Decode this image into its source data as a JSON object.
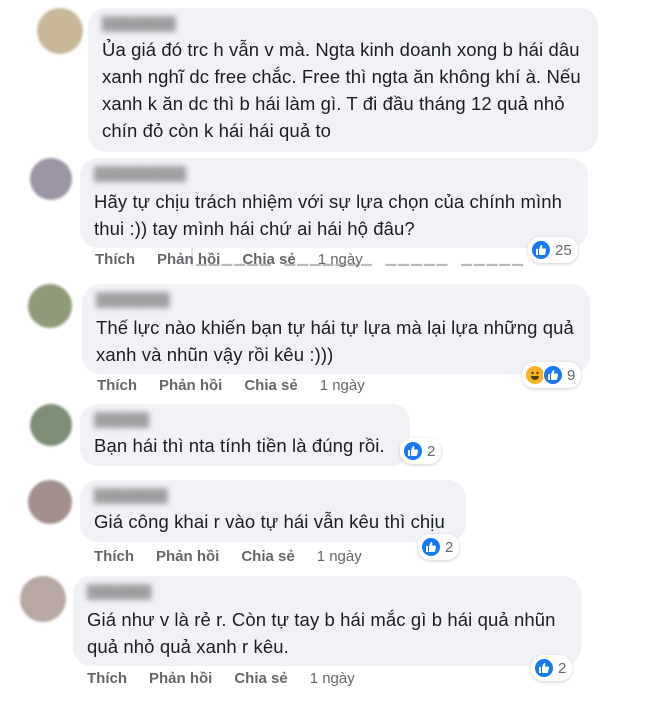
{
  "colors": {
    "bubble_bg": "#f0f2f5",
    "like_blue": "#1877f2",
    "haha_yellow": "#f7b125",
    "meta_gray": "#65676b"
  },
  "icons": {
    "like": "like-thumb-icon",
    "haha": "haha-face-icon"
  },
  "comments": [
    {
      "text": "Ủa giá đó trc h vẫn v mà. Ngta kinh doanh xong b hái dâu xanh nghĩ dc free chắc. Free thì ngta ăn không khí à. Nếu xanh k ăn dc thì b hái làm gì. T đi đầu tháng 12 quả nhỏ chín đỏ còn k hái hái quả to"
    },
    {
      "text": "Hãy tự chịu trách nhiệm với sự lựa chọn của chính mình thui :)) tay mình hái chứ ai hái hộ đâu?",
      "reactions": "25",
      "actions": {
        "like": "Thích",
        "reply": "Phản hồi",
        "share": "Chia sẻ",
        "time": "1 ngày"
      }
    },
    {
      "text": "Thế lực nào khiến bạn tự hái tự lựa mà lại lựa những quả xanh và nhũn vậy rồi kêu :)))",
      "reactions": "9",
      "actions": {
        "like": "Thích",
        "reply": "Phản hồi",
        "share": "Chia sẻ",
        "time": "1 ngày"
      }
    },
    {
      "text": "Bạn hái thì nta tính tiền là đúng rồi.",
      "reactions": "2"
    },
    {
      "text": "Giá công khai r vào tự hái vẫn kêu thì chịu",
      "reactions": "2",
      "actions": {
        "like": "Thích",
        "reply": "Phản hồi",
        "share": "Chia sẻ",
        "time": "1 ngày"
      }
    },
    {
      "text": "Giá như v là rẻ r. Còn tự tay b hái mắc gì b hái quả nhũn quả nhỏ quả xanh r kêu.",
      "reactions": "2",
      "actions": {
        "like": "Thích",
        "reply": "Phản hồi",
        "share": "Chia sẻ",
        "time": "1 ngày"
      }
    }
  ]
}
